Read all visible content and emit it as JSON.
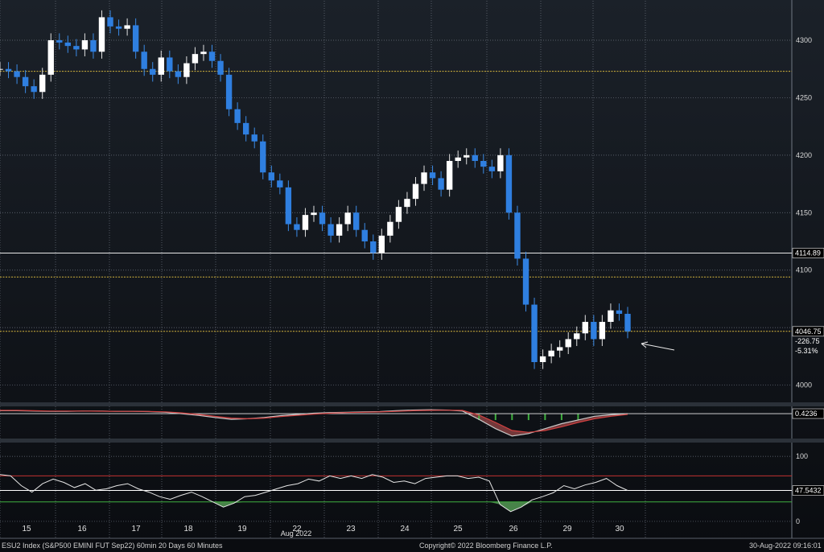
{
  "chart_data": [
    {
      "type": "candlestick",
      "x_ticks": [
        "15",
        "16",
        "17",
        "18",
        "19",
        "22",
        "23",
        "24",
        "25",
        "26",
        "29",
        "30"
      ],
      "x_month_label": "Aug 2022",
      "ylim": [
        3985,
        4335
      ],
      "y_ticks": [
        4000,
        4050,
        4100,
        4150,
        4200,
        4250,
        4300
      ],
      "y_tick_labels": [
        "4000",
        "",
        "4100",
        "4150",
        "4200",
        "4250",
        "4300"
      ],
      "series": [
        {
          "path": [
            4275,
            4273,
            4268,
            4260,
            4255,
            4270,
            4300,
            4298,
            4295,
            4292,
            4300,
            4290,
            4320,
            4312,
            4310,
            4313,
            4290,
            4275,
            4270,
            4285,
            4273,
            4268,
            4280,
            4288,
            4290,
            4282,
            4270,
            4240,
            4228,
            4218,
            4212,
            4185,
            4178,
            4172,
            4140,
            4135,
            4148,
            4150,
            4140,
            4130,
            4140,
            4150,
            4135,
            4125,
            4115,
            4130,
            4142,
            4155,
            4162,
            4175,
            4185,
            4180,
            4170,
            4195,
            4198,
            4200,
            4195,
            4190,
            4186,
            4200,
            4150,
            4110,
            4070,
            4020,
            4025,
            4030,
            4033,
            4040,
            4045,
            4055,
            4040,
            4055,
            4065,
            4062,
            4046.75
          ]
        }
      ],
      "horizontal_lines": [
        {
          "value": 4273,
          "color": "#d4b43c"
        },
        {
          "value": 4114.89,
          "color": "#e8e8e8"
        },
        {
          "value": 4094,
          "color": "#d4b43c"
        },
        {
          "value": 4046.75,
          "color": "#d4b43c"
        }
      ],
      "labels": {
        "level": "4114.89",
        "last": "4046.75",
        "change": "-226.75",
        "change_pct": "-5.31%"
      }
    },
    {
      "type": "line",
      "last_value_label": "0.4236",
      "series": [
        {
          "color": "#c8c8c8",
          "path": [
            0.9,
            0.9,
            0.85,
            0.8,
            0.8,
            0.85,
            0.85,
            0.8,
            0.8,
            0.75,
            0.65,
            0.4,
            0.15,
            -0.2,
            -0.5,
            -0.4,
            -0.2,
            0.1,
            0.3,
            0.5,
            0.6,
            0.65,
            0.7,
            0.75,
            0.9,
            1.0,
            1.05,
            1.0,
            0.85,
            -0.5,
            -2.0,
            -3.2,
            -2.8,
            -2.0,
            -1.2,
            -0.6,
            0.0,
            0.25,
            0.4236
          ]
        },
        {
          "color": "#d04040",
          "path": [
            0.95,
            0.95,
            0.9,
            0.85,
            0.85,
            0.85,
            0.82,
            0.8,
            0.8,
            0.78,
            0.72,
            0.55,
            0.3,
            0.0,
            -0.3,
            -0.4,
            -0.3,
            -0.05,
            0.15,
            0.35,
            0.5,
            0.6,
            0.65,
            0.7,
            0.8,
            0.9,
            0.95,
            0.98,
            0.95,
            0.2,
            -1.0,
            -2.3,
            -2.6,
            -2.3,
            -1.7,
            -1.0,
            -0.4,
            0.0,
            0.3
          ]
        }
      ]
    },
    {
      "type": "line",
      "last_value_label": "47.5432",
      "y_ticks": [
        0,
        100
      ],
      "y_tick_labels": [
        "0",
        "100"
      ],
      "ylim": [
        -5,
        115
      ],
      "horizontal_lines": [
        {
          "value": 70,
          "color": "#c03030"
        },
        {
          "value": 30,
          "color": "#40b040"
        },
        {
          "value": 47.5432,
          "color": "#ffffff"
        }
      ],
      "series": [
        {
          "color": "#e6e6e6",
          "path": [
            72,
            70,
            55,
            45,
            58,
            65,
            60,
            52,
            58,
            48,
            50,
            55,
            58,
            50,
            45,
            38,
            34,
            40,
            45,
            38,
            30,
            22,
            28,
            38,
            40,
            45,
            50,
            55,
            58,
            65,
            62,
            70,
            66,
            70,
            66,
            72,
            68,
            60,
            62,
            58,
            66,
            68,
            70,
            70,
            66,
            68,
            62,
            26,
            15,
            22,
            33,
            38,
            44,
            55,
            50,
            56,
            60,
            66,
            55,
            47.5432
          ]
        }
      ]
    }
  ],
  "footer": {
    "left": "ESU2 Index (S&P500 EMINI FUT  Sep22) 60min 20 Days 60 Minutes",
    "center": "Copyright© 2022 Bloomberg Finance L.P.",
    "right": "30-Aug-2022 09:16:01"
  }
}
